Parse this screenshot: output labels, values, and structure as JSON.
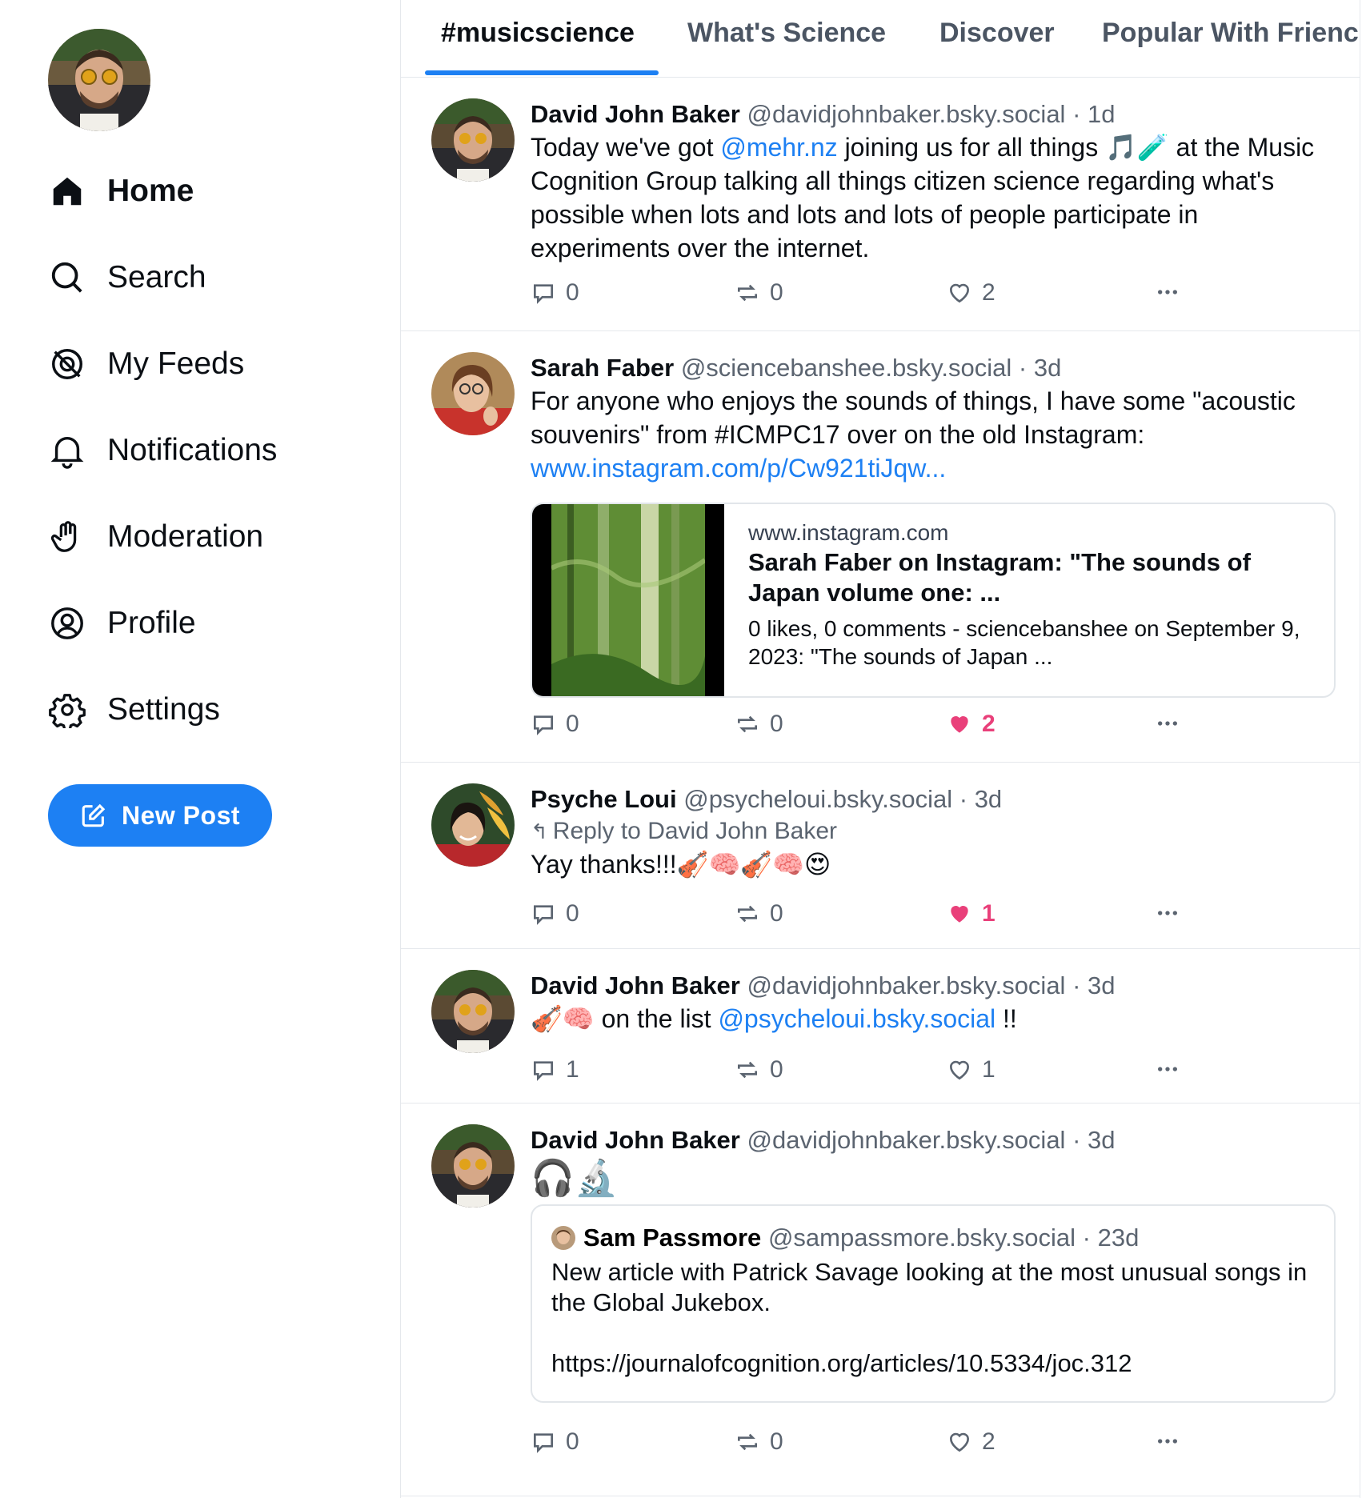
{
  "sidebar": {
    "nav": [
      {
        "label": "Home",
        "icon": "home-icon",
        "active": true
      },
      {
        "label": "Search",
        "icon": "search-icon"
      },
      {
        "label": "My Feeds",
        "icon": "feeds-icon"
      },
      {
        "label": "Notifications",
        "icon": "bell-icon"
      },
      {
        "label": "Moderation",
        "icon": "hand-icon"
      },
      {
        "label": "Profile",
        "icon": "profile-icon"
      },
      {
        "label": "Settings",
        "icon": "gear-icon"
      }
    ],
    "new_post_label": "New Post"
  },
  "tabs": [
    {
      "label": "#musicscience",
      "active": true
    },
    {
      "label": "What's Science"
    },
    {
      "label": "Discover"
    },
    {
      "label": "Popular With Frienc"
    }
  ],
  "posts": [
    {
      "author": "David John Baker",
      "handle": "@davidjohnbaker.bsky.social",
      "time": "1d",
      "text_before": "Today we've got ",
      "mention": "@mehr.nz",
      "text_after": " joining us for all things 🎵🧪 at the Music Cognition Group talking all things citizen science regarding what's possible when lots and lots and lots of people participate in experiments over the internet.",
      "replies": "0",
      "reposts": "0",
      "likes": "2",
      "liked": false
    },
    {
      "author": "Sarah Faber",
      "handle": "@sciencebanshee.bsky.social",
      "time": "3d",
      "text": "For anyone who enjoys the sounds of things, I have some \"acoustic souvenirs\" from #ICMPC17 over on the old Instagram:",
      "link": "www.instagram.com/p/Cw921tiJqw...",
      "embed": {
        "domain": "www.instagram.com",
        "title": "Sarah Faber on Instagram: \"The sounds of Japan volume one: ...",
        "description": "0 likes, 0 comments - sciencebanshee on September 9, 2023: \"The sounds of Japan ..."
      },
      "replies": "0",
      "reposts": "0",
      "likes": "2",
      "liked": true
    },
    {
      "author": "Psyche Loui",
      "handle": "@psycheloui.bsky.social",
      "time": "3d",
      "reply_label": "Reply to",
      "reply_to": "David John Baker",
      "text": "Yay thanks!!!🎻🧠🎻🧠😍",
      "replies": "0",
      "reposts": "0",
      "likes": "1",
      "liked": true
    },
    {
      "author": "David John Baker",
      "handle": "@davidjohnbaker.bsky.social",
      "time": "3d",
      "text_before": "🎻🧠 on the list ",
      "mention": "@psycheloui.bsky.social",
      "text_after": " !!",
      "replies": "1",
      "reposts": "0",
      "likes": "1",
      "liked": false
    },
    {
      "author": "David John Baker",
      "handle": "@davidjohnbaker.bsky.social",
      "time": "3d",
      "text": "🎧🔬",
      "quote": {
        "author": "Sam Passmore",
        "handle": "@sampassmore.bsky.social",
        "time": "23d",
        "text": "New article with Patrick Savage looking at the most unusual songs in the Global Jukebox.",
        "url": "https://journalofcognition.org/articles/10.5334/joc.312"
      },
      "replies": "0",
      "reposts": "0",
      "likes": "2",
      "liked": false
    }
  ],
  "colors": {
    "accent": "#1d80f3",
    "like": "#e9407a",
    "muted": "#5b6470",
    "border": "#e5e8ec"
  }
}
